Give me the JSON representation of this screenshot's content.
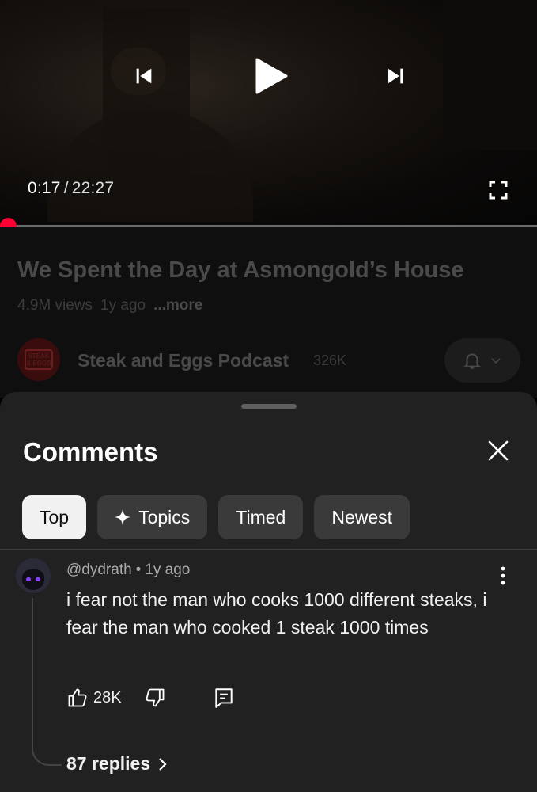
{
  "player": {
    "current_time": "0:17",
    "separator": "/",
    "duration": "22:27",
    "progress_fraction": 0.013,
    "icons": {
      "prev": "skip-previous-icon",
      "play": "play-icon",
      "next": "skip-next-icon",
      "fullscreen": "fullscreen-icon"
    },
    "accent_color": "#ff0033"
  },
  "video": {
    "title": "We Spent the Day at Asmongold’s House",
    "views": "4.9M views",
    "age": "1y ago",
    "more_label": "...more"
  },
  "channel": {
    "name": "Steak and Eggs Podcast",
    "subscribers": "326K",
    "avatar_logo_text": "STEAK & EGGS PODCAST"
  },
  "comments": {
    "title": "Comments",
    "filters": [
      {
        "label": "Top",
        "active": true
      },
      {
        "label": "Topics",
        "icon": "sparkle-icon"
      },
      {
        "label": "Timed"
      },
      {
        "label": "Newest"
      }
    ],
    "items": [
      {
        "author": "@dydrath",
        "separator": "•",
        "age": "1y ago",
        "text": "i fear not the man who cooks 1000 different steaks, i fear the man who cooked 1 steak 1000 times",
        "likes": "28K",
        "replies_label": "87 replies"
      }
    ]
  }
}
